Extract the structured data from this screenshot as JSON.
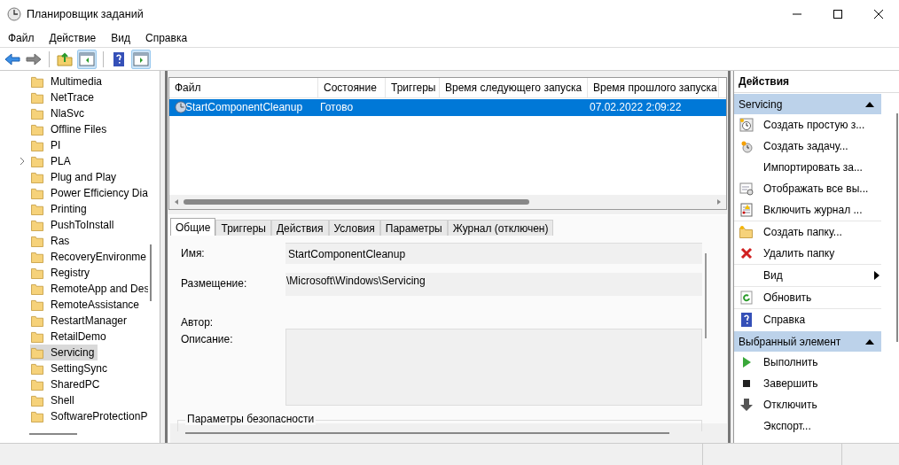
{
  "window": {
    "title": "Планировщик заданий"
  },
  "menu": [
    "Файл",
    "Действие",
    "Вид",
    "Справка"
  ],
  "tree": [
    {
      "label": "Multimedia",
      "selected": false,
      "expandable": false
    },
    {
      "label": "NetTrace",
      "selected": false,
      "expandable": false
    },
    {
      "label": "NlaSvc",
      "selected": false,
      "expandable": false
    },
    {
      "label": "Offline Files",
      "selected": false,
      "expandable": false
    },
    {
      "label": "PI",
      "selected": false,
      "expandable": false
    },
    {
      "label": "PLA",
      "selected": false,
      "expandable": true
    },
    {
      "label": "Plug and Play",
      "selected": false,
      "expandable": false
    },
    {
      "label": "Power Efficiency Dia",
      "selected": false,
      "expandable": false
    },
    {
      "label": "Printing",
      "selected": false,
      "expandable": false
    },
    {
      "label": "PushToInstall",
      "selected": false,
      "expandable": false
    },
    {
      "label": "Ras",
      "selected": false,
      "expandable": false
    },
    {
      "label": "RecoveryEnvironme",
      "selected": false,
      "expandable": false
    },
    {
      "label": "Registry",
      "selected": false,
      "expandable": false
    },
    {
      "label": "RemoteApp and Des",
      "selected": false,
      "expandable": false
    },
    {
      "label": "RemoteAssistance",
      "selected": false,
      "expandable": false
    },
    {
      "label": "RestartManager",
      "selected": false,
      "expandable": false
    },
    {
      "label": "RetailDemo",
      "selected": false,
      "expandable": false
    },
    {
      "label": "Servicing",
      "selected": true,
      "expandable": false
    },
    {
      "label": "SettingSync",
      "selected": false,
      "expandable": false
    },
    {
      "label": "SharedPC",
      "selected": false,
      "expandable": false
    },
    {
      "label": "Shell",
      "selected": false,
      "expandable": false
    },
    {
      "label": "SoftwareProtectionP",
      "selected": false,
      "expandable": false
    }
  ],
  "table": {
    "columns": [
      "Файл",
      "Состояние",
      "Триггеры",
      "Время следующего запуска",
      "Время прошлого запуска"
    ],
    "rows": [
      {
        "cells": [
          "StartComponentCleanup",
          "Готово",
          null,
          null,
          "07.02.2022 2:09:22"
        ],
        "selected": true
      }
    ]
  },
  "tabs": [
    {
      "label": "Общие",
      "selected": true
    },
    {
      "label": "Триггеры",
      "selected": false
    },
    {
      "label": "Действия",
      "selected": false
    },
    {
      "label": "Условия",
      "selected": false
    },
    {
      "label": "Параметры",
      "selected": false
    },
    {
      "label": "Журнал (отключен)",
      "selected": false
    }
  ],
  "form": [
    {
      "kind": "field",
      "label": "Имя:",
      "value": "StartComponentCleanup"
    },
    {
      "kind": "block",
      "label": "Размещение:",
      "value": "\\Microsoft\\Windows\\Servicing"
    },
    {
      "kind": "plain",
      "label": "Автор:"
    },
    {
      "kind": "area",
      "label": "Описание:"
    }
  ],
  "group_title": "Параметры безопасности",
  "actions": {
    "title": "Действия",
    "sections": [
      {
        "title": "Servicing",
        "expanded": true,
        "items": [
          {
            "label": "Создать простую з...",
            "submenu": false
          },
          {
            "label": "Создать задачу...",
            "submenu": false
          },
          {
            "label": "Импортировать за...",
            "submenu": false
          },
          {
            "label": "Отображать все вы...",
            "submenu": false
          },
          {
            "label": "Включить журнал ...",
            "submenu": false
          },
          {
            "label": "Создать папку...",
            "submenu": false
          },
          {
            "label": "Удалить папку",
            "submenu": false
          },
          {
            "label": "Вид",
            "submenu": true
          },
          {
            "label": "Обновить",
            "submenu": false
          },
          {
            "label": "Справка",
            "submenu": false
          }
        ]
      },
      {
        "title": "Выбранный элемент",
        "expanded": true,
        "items": [
          {
            "label": "Выполнить",
            "submenu": false
          },
          {
            "label": "Завершить",
            "submenu": false
          },
          {
            "label": "Отключить",
            "submenu": false
          },
          {
            "label": "Экспорт...",
            "submenu": false
          }
        ]
      }
    ]
  }
}
